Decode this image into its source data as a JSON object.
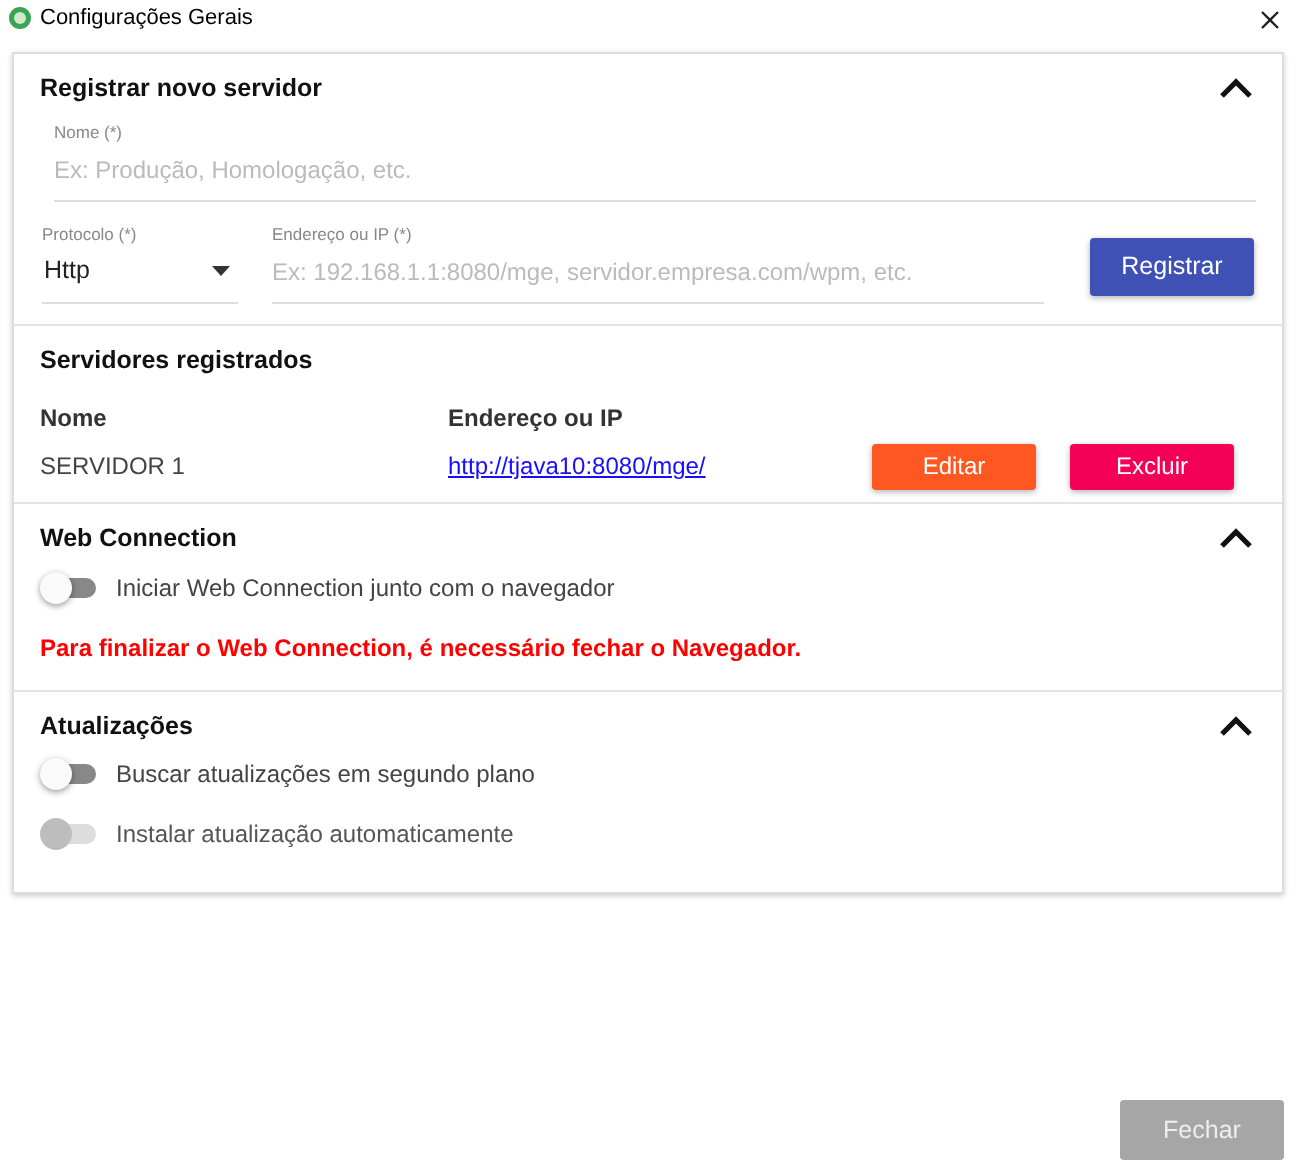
{
  "window": {
    "title": "Configurações Gerais"
  },
  "register": {
    "title": "Registrar novo servidor",
    "expanded": true,
    "name_field": {
      "label": "Nome (*)",
      "placeholder": "Ex: Produção, Homologação, etc."
    },
    "protocol_field": {
      "label": "Protocolo (*)",
      "value": "Http"
    },
    "address_field": {
      "label": "Endereço ou IP (*)",
      "placeholder": "Ex: 192.168.1.1:8080/mge, servidor.empresa.com/wpm, etc."
    },
    "button": "Registrar"
  },
  "servers": {
    "title": "Servidores registrados",
    "columns": [
      "Nome",
      "Endereço ou IP"
    ],
    "rows": [
      {
        "name": "SERVIDOR 1",
        "address": "http://tjava10:8080/mge/",
        "edit": "Editar",
        "delete": "Excluir"
      }
    ]
  },
  "web_connection": {
    "title": "Web Connection",
    "expanded": true,
    "toggles": [
      {
        "label": "Iniciar Web Connection junto com o navegador",
        "on": false,
        "disabled": false
      }
    ],
    "warning": "Para finalizar o Web Connection, é necessário fechar o Navegador."
  },
  "updates": {
    "title": "Atualizações",
    "expanded": true,
    "toggles": [
      {
        "label": "Buscar atualizações em segundo plano",
        "on": false,
        "disabled": false
      },
      {
        "label": "Instalar atualização automaticamente",
        "on": false,
        "disabled": true
      }
    ]
  },
  "close_button": {
    "label": "Fechar",
    "disabled": true
  }
}
